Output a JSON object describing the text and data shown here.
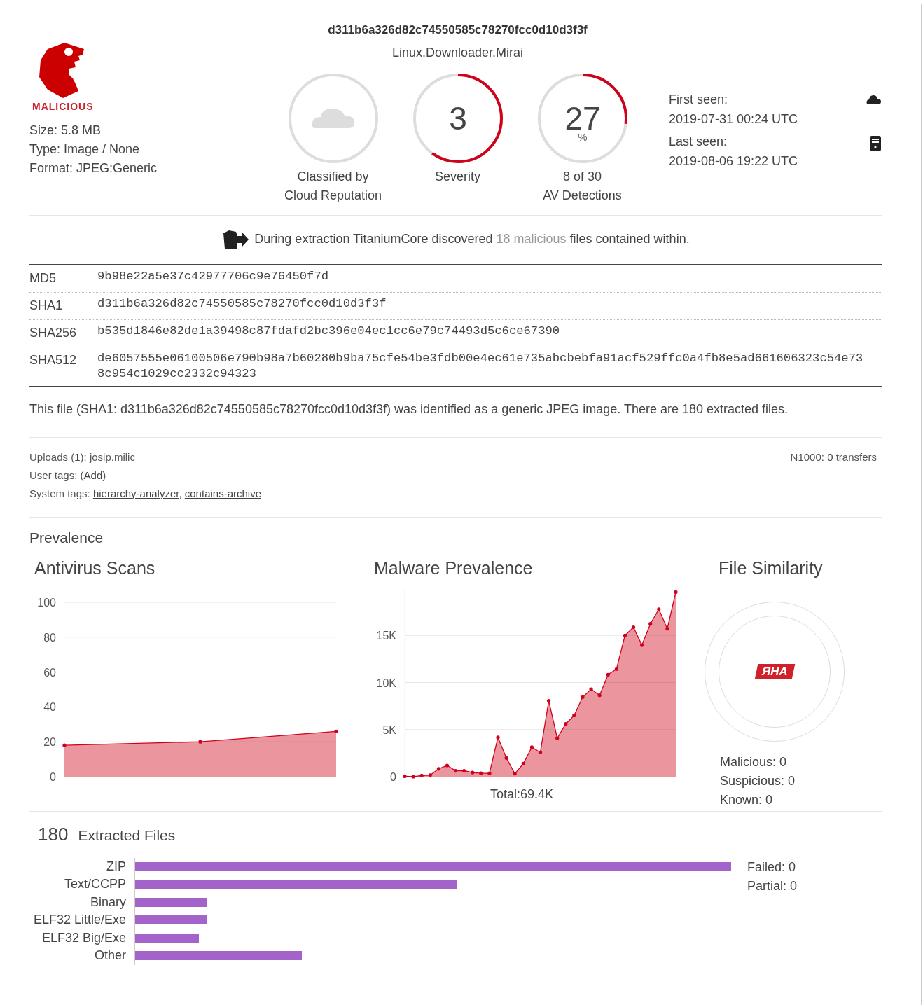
{
  "verdict": {
    "label": "MALICIOUS"
  },
  "file_info": [
    "Size: 5.8 MB",
    "Type: Image / None",
    "Format: JPEG:Generic"
  ],
  "header": {
    "hash": "d311b6a326d82c74550585c78270fcc0d10d3f3f",
    "threat_name": "Linux.Downloader.Mirai"
  },
  "gauges": [
    {
      "kind": "icon",
      "caption": [
        "Classified by",
        "Cloud Reputation"
      ]
    },
    {
      "kind": "number",
      "value": "3",
      "level": 0.6,
      "caption": [
        "Severity"
      ]
    },
    {
      "kind": "percent",
      "value": "27",
      "unit": "%",
      "level": 0.27,
      "caption": [
        "8 of 30",
        "AV Detections"
      ]
    }
  ],
  "seen": [
    {
      "label": "First seen:",
      "value": "2019-07-31 00:24 UTC"
    },
    {
      "label": "Last seen:",
      "value": "2019-08-06 19:22 UTC"
    }
  ],
  "extraction_notice": [
    {
      "text": "During extraction TitaniumCore discovered "
    },
    {
      "text": "18 malicious",
      "link": true
    },
    {
      "text": " files contained within."
    }
  ],
  "hashes": [
    {
      "name": "MD5",
      "value": "9b98e22a5e37c42977706c9e76450f7d"
    },
    {
      "name": "SHA1",
      "value": "d311b6a326d82c74550585c78270fcc0d10d3f3f"
    },
    {
      "name": "SHA256",
      "value": "b535d1846e82de1a39498c87fdafd2bc396e04ec1cc6e79c74493d5c6ce67390"
    },
    {
      "name": "SHA512",
      "value": "de6057555e06100506e790b98a7b60280b9ba75cfe54be3fdb00e4ec61e735abcbebfa91acf529ffc0a4fb8e5ad661606323c54e738c954c1029cc2332c94323"
    }
  ],
  "description": "This file (SHA1: d311b6a326d82c74550585c78270fcc0d10d3f3f) was identified as a generic JPEG image. There are 180 extracted files.",
  "meta": [
    [
      {
        "text": "Uploads ("
      },
      {
        "text": "1",
        "link": true
      },
      {
        "text": "): josip.milic"
      }
    ],
    [
      {
        "text": "User tags: ("
      },
      {
        "text": "Add",
        "link": true
      },
      {
        "text": ")"
      }
    ],
    [
      {
        "text": "System tags: "
      },
      {
        "text": "hierarchy-analyzer",
        "link": true
      },
      {
        "text": ", "
      },
      {
        "text": "contains-archive",
        "link": true
      }
    ]
  ],
  "n1000": [
    {
      "text": "N1000: "
    },
    {
      "text": "0",
      "link": true
    },
    {
      "text": " transfers"
    }
  ],
  "prevalence": {
    "title": "Prevalence",
    "antivirus": {
      "title": "Antivirus Scans",
      "chart_data": {
        "type": "area",
        "grid": true,
        "series": [
          {
            "color": "#d0021b",
            "values": [
              18,
              20,
              26
            ]
          }
        ],
        "ylim": [
          0,
          100
        ],
        "yticks": [
          0,
          20,
          40,
          60,
          80,
          100
        ]
      }
    },
    "malware": {
      "title": "Malware Prevalence",
      "total": "Total:69.4K",
      "chart_data": {
        "type": "area",
        "grid": true,
        "series": [
          {
            "color": "#d0021b",
            "values": [
              40,
              0,
              120,
              160,
              830,
              1190,
              630,
              630,
              440,
              360,
              360,
              4170,
              1980,
              320,
              1390,
              3130,
              2580,
              8060,
              4090,
              5600,
              6510,
              8450,
              9290,
              8650,
              10830,
              11430,
              15000,
              15870,
              13970,
              16230,
              17780,
              15710,
              19600
            ]
          }
        ],
        "ylim": [
          0,
          20000
        ],
        "yticks": [
          0,
          {
            "value": 5000,
            "label": "5K"
          },
          {
            "value": 10000,
            "label": "10K"
          },
          {
            "value": 15000,
            "label": "15K"
          }
        ]
      }
    },
    "similarity": {
      "title": "File Similarity",
      "logo_text": "ЯHA",
      "stats": [
        "Malicious: 0",
        "Suspicious: 0",
        "Known: 0"
      ]
    }
  },
  "extracted": {
    "count": "180",
    "title": "Extracted Files",
    "bars": [
      {
        "label": "ZIP",
        "level": 1.0
      },
      {
        "label": "Text/CCPP",
        "level": 0.54
      },
      {
        "label": "Binary",
        "level": 0.12
      },
      {
        "label": "ELF32 Little/Exe",
        "level": 0.12
      },
      {
        "label": "ELF32 Big/Exe",
        "level": 0.107
      },
      {
        "label": "Other",
        "level": 0.28
      }
    ],
    "status": [
      "Failed: 0",
      "Partial: 0"
    ]
  }
}
